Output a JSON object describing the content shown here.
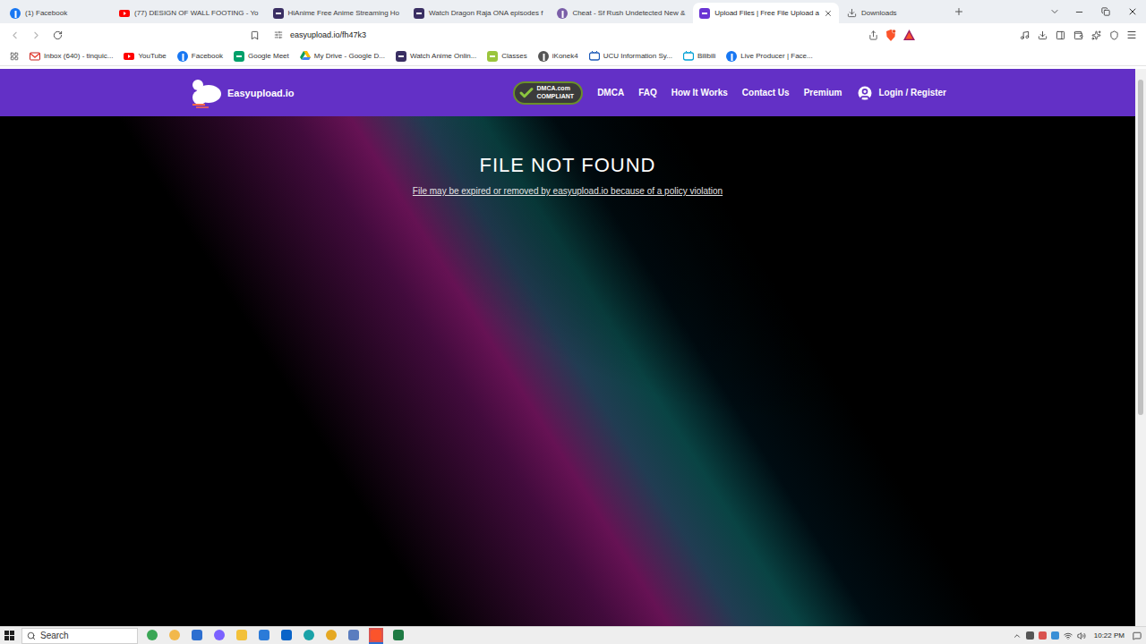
{
  "browser": {
    "tabs": [
      {
        "label": "(1) Facebook",
        "selected": false,
        "kind": "facebook"
      },
      {
        "label": "(77) DESIGN OF WALL FOOTING - Yo",
        "selected": false,
        "kind": "youtube"
      },
      {
        "label": "HiAnime Free Anime Streaming Ho",
        "selected": false,
        "kind": "hianime"
      },
      {
        "label": "Watch Dragon Raja ONA episodes f",
        "selected": false,
        "kind": "hianime"
      },
      {
        "label": "Cheat - Sf Rush Undetected New &",
        "selected": false,
        "kind": "shield"
      },
      {
        "label": "Upload Files | Free File Upload a",
        "selected": true,
        "kind": "upload"
      },
      {
        "label": "Downloads",
        "selected": false,
        "kind": "download"
      }
    ],
    "address": "easyupload.io/fh47k3",
    "bookmarks": [
      {
        "label": "Inbox (640) - tinquic...",
        "kind": "gmail"
      },
      {
        "label": "YouTube",
        "kind": "youtube"
      },
      {
        "label": "Facebook",
        "kind": "facebook"
      },
      {
        "label": "Google Meet",
        "kind": "meet"
      },
      {
        "label": "My Drive - Google D...",
        "kind": "drive"
      },
      {
        "label": "Watch Anime Onlin...",
        "kind": "hianime"
      },
      {
        "label": "Classes",
        "kind": "classes"
      },
      {
        "label": "iKonek4",
        "kind": "ikonek"
      },
      {
        "label": "UCU Information Sy...",
        "kind": "ucu"
      },
      {
        "label": "Bilibili",
        "kind": "bilibili"
      },
      {
        "label": "Live Producer | Face...",
        "kind": "facebook"
      }
    ]
  },
  "page": {
    "logo": "Easyupload.io",
    "dmca_badge": [
      "DMCA.com",
      "COMPLIANT"
    ],
    "nav": [
      "DMCA",
      "FAQ",
      "How It Works",
      "Contact Us",
      "Premium"
    ],
    "login": "Login / Register",
    "title": "FILE NOT FOUND",
    "message": "File may be expired or removed by easyupload.io because of a policy violation"
  },
  "taskbar": {
    "search_placeholder": "Search",
    "apps": [
      {
        "kind": "widgets",
        "active": false
      },
      {
        "kind": "weather",
        "active": false
      },
      {
        "kind": "security",
        "active": false
      },
      {
        "kind": "copilot",
        "active": false
      },
      {
        "kind": "explorer",
        "active": false
      },
      {
        "kind": "store",
        "active": false
      },
      {
        "kind": "outlook",
        "active": false
      },
      {
        "kind": "edge",
        "active": false
      },
      {
        "kind": "chrome",
        "active": false
      },
      {
        "kind": "photos",
        "active": false
      },
      {
        "kind": "brave",
        "active": true
      },
      {
        "kind": "excel",
        "active": false
      }
    ],
    "time": "10:22 PM"
  }
}
